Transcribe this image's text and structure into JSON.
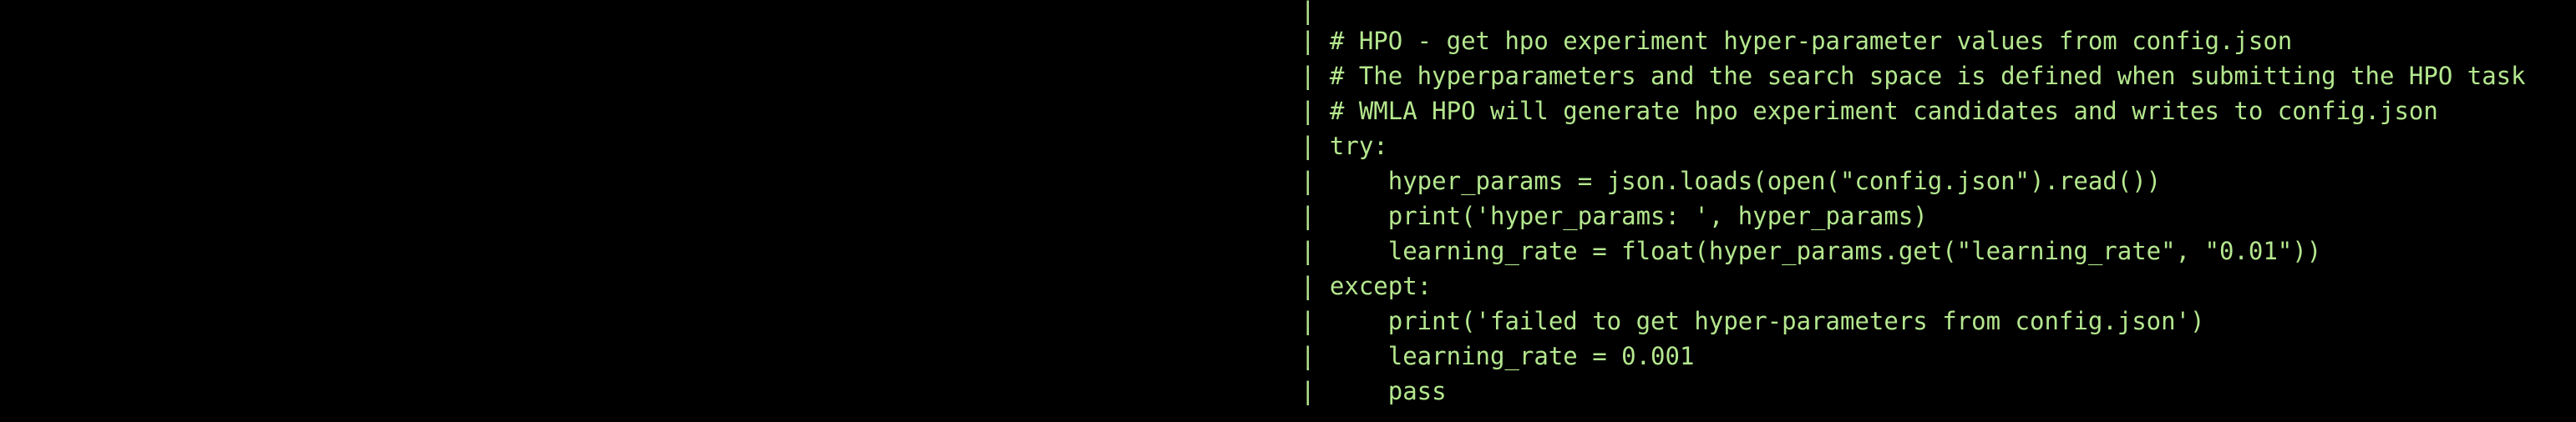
{
  "terminal": {
    "colors": {
      "background": "#000000",
      "text": "#b4e78e"
    },
    "gutter": "|",
    "lines": [
      "",
      " # HPO - get hpo experiment hyper-parameter values from config.json",
      " # The hyperparameters and the search space is defined when submitting the HPO task",
      " # WMLA HPO will generate hpo experiment candidates and writes to config.json",
      " try:",
      "     hyper_params = json.loads(open(\"config.json\").read())",
      "     print('hyper_params: ', hyper_params)",
      "     learning_rate = float(hyper_params.get(\"learning_rate\", \"0.01\"))",
      " except:",
      "     print('failed to get hyper-parameters from config.json')",
      "     learning_rate = 0.001",
      "     pass"
    ]
  }
}
